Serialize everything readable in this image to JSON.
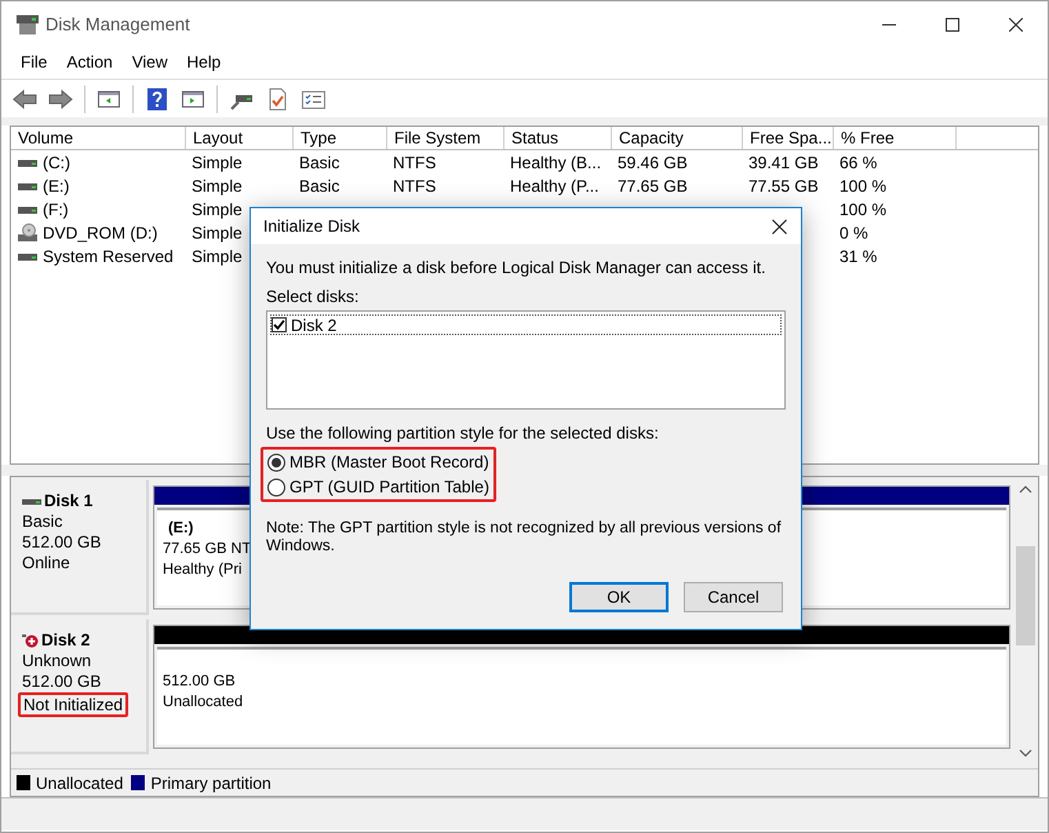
{
  "window": {
    "title": "Disk Management"
  },
  "menu": [
    "File",
    "Action",
    "View",
    "Help"
  ],
  "toolbar": [
    {
      "kind": "back"
    },
    {
      "kind": "forward"
    },
    {
      "kind": "sep"
    },
    {
      "kind": "panel"
    },
    {
      "kind": "sep"
    },
    {
      "kind": "help"
    },
    {
      "kind": "panel2"
    },
    {
      "kind": "sep"
    },
    {
      "kind": "connect"
    },
    {
      "kind": "check"
    },
    {
      "kind": "list"
    }
  ],
  "volumes": {
    "columns": [
      "Volume",
      "Layout",
      "Type",
      "File System",
      "Status",
      "Capacity",
      "Free Spa...",
      "% Free"
    ],
    "rows": [
      {
        "kind": "drive",
        "volume": "(C:)",
        "layout": "Simple",
        "type": "Basic",
        "file_system": "NTFS",
        "status": "Healthy (B...",
        "capacity": "59.46 GB",
        "free_space": "39.41 GB",
        "pct_free": "66 %"
      },
      {
        "kind": "drive",
        "volume": "(E:)",
        "layout": "Simple",
        "type": "Basic",
        "file_system": "NTFS",
        "status": "Healthy (P...",
        "capacity": "77.65 GB",
        "free_space": "77.55 GB",
        "pct_free": "100 %"
      },
      {
        "kind": "drive",
        "volume": "(F:)",
        "layout": "Simple",
        "pct_free": "100 %"
      },
      {
        "kind": "dvd",
        "volume": "DVD_ROM (D:)",
        "layout": "Simple",
        "pct_free": "0 %"
      },
      {
        "kind": "drive",
        "volume": "System Reserved",
        "layout": "Simple",
        "pct_free": "31 %"
      }
    ]
  },
  "disks": [
    {
      "name": "Disk 1",
      "kind": "online",
      "type": "Basic",
      "size": "512.00 GB",
      "status": "Online",
      "status_highlighted": false,
      "partition": {
        "kind": "primary",
        "label": "(E:)",
        "size": "77.65 GB NT",
        "status": "Healthy (Pri"
      }
    },
    {
      "name": "Disk 2",
      "kind": "error",
      "type": "Unknown",
      "size": "512.00 GB",
      "status": "Not Initialized",
      "status_highlighted": true,
      "partition": {
        "kind": "unallocated",
        "size": "512.00 GB",
        "status": "Unallocated"
      }
    }
  ],
  "legend": [
    {
      "label": "Unallocated",
      "color": "#000000"
    },
    {
      "label": "Primary partition",
      "color": "#000080"
    }
  ],
  "dialog": {
    "title": "Initialize Disk",
    "message": "You must initialize a disk before Logical Disk Manager can access it.",
    "select_label": "Select disks:",
    "disks": [
      {
        "label": "Disk 2",
        "checked": true
      }
    ],
    "style_label": "Use the following partition style for the selected disks:",
    "styles_highlighted": true,
    "styles": [
      {
        "label": "MBR (Master Boot Record)",
        "selected": true
      },
      {
        "label": "GPT (GUID Partition Table)",
        "selected": false
      }
    ],
    "note": "Note: The GPT partition style is not recognized by all previous versions of Windows.",
    "buttons": [
      {
        "label": "OK",
        "default": true
      },
      {
        "label": "Cancel",
        "default": false
      }
    ]
  }
}
